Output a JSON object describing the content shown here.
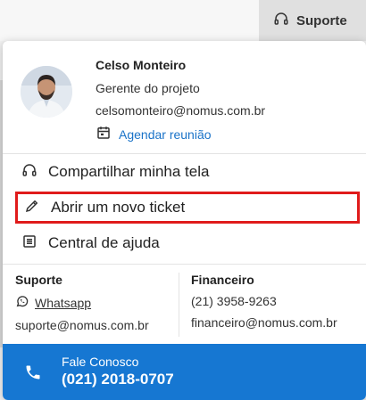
{
  "topbar": {
    "support_label": "Suporte"
  },
  "profile": {
    "name": "Celso Monteiro",
    "role": "Gerente do projeto",
    "email": "celsomonteiro@nomus.com.br",
    "schedule_label": "Agendar reunião"
  },
  "menu": {
    "items": [
      {
        "label": "Compartilhar minha tela",
        "icon": "headset-icon"
      },
      {
        "label": "Abrir um novo ticket",
        "icon": "pencil-icon"
      },
      {
        "label": "Central de ajuda",
        "icon": "list-icon"
      }
    ]
  },
  "contacts": {
    "support": {
      "title": "Suporte",
      "whatsapp": "Whatsapp",
      "email": "suporte@nomus.com.br"
    },
    "finance": {
      "title": "Financeiro",
      "phone": "(21) 3958-9263",
      "email": "financeiro@nomus.com.br"
    }
  },
  "footer": {
    "label": "Fale Conosco",
    "number": "(021) 2018-0707"
  },
  "colors": {
    "accent": "#1677d2",
    "link": "#1a73c8",
    "highlight": "#e01b1b"
  }
}
